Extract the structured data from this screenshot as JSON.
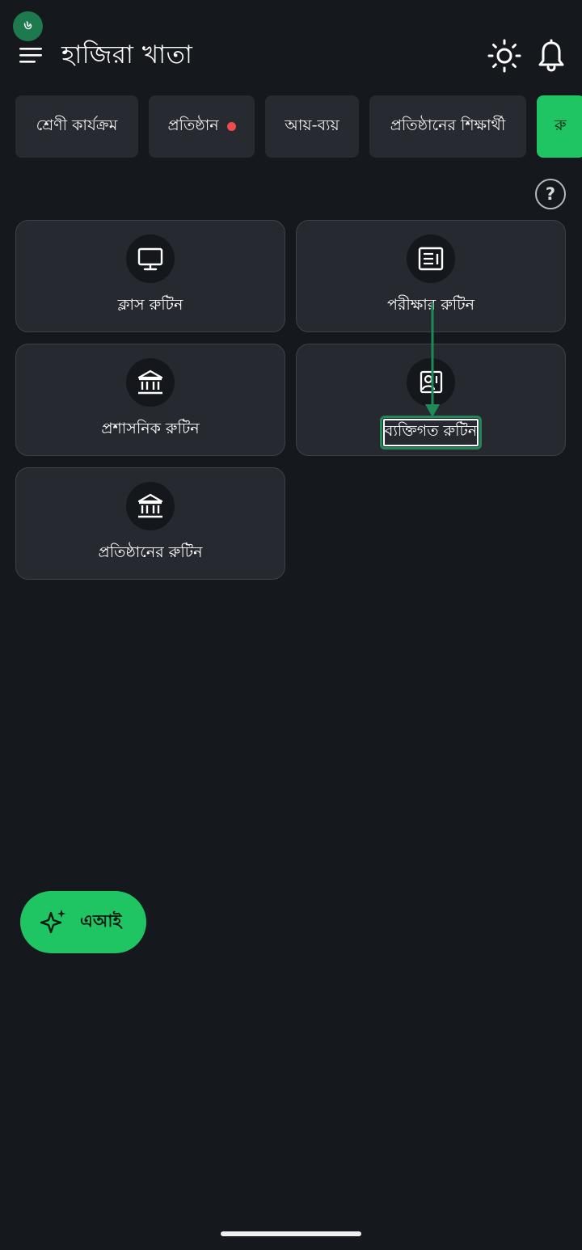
{
  "status": {
    "badge": "৬"
  },
  "header": {
    "title": "হাজিরা খাতা"
  },
  "icons": {
    "menu": "menu-icon",
    "theme": "sun-icon",
    "notifications": "bell-icon",
    "help": "help-icon"
  },
  "help": {
    "glyph": "?"
  },
  "tabs": [
    {
      "label": "শ্রেণী কার্যক্রম"
    },
    {
      "label": "প্রতিষ্ঠান"
    },
    {
      "label": "আয়-ব্যয়"
    },
    {
      "label": "প্রতিষ্ঠানের শিক্ষার্থী"
    },
    {
      "label": "রু"
    }
  ],
  "cards": [
    {
      "label": "ক্লাস রুটিন",
      "icon": "monitor-icon"
    },
    {
      "label": "পরীক্ষার রুটিন",
      "icon": "document-list-icon"
    },
    {
      "label": "প্রশাসনিক রুটিন",
      "icon": "institution-icon"
    },
    {
      "label": "ব্যক্তিগত রুটিন",
      "icon": "person-board-icon"
    },
    {
      "label": "প্রতিষ্ঠানের রুটিন",
      "icon": "institution-icon"
    }
  ],
  "fab": {
    "label": "এআই",
    "icon": "sparkle-icon"
  },
  "colors": {
    "background": "#15181c",
    "card": "#262a30",
    "accent": "#20c563",
    "notification_dot": "#ef4b4b",
    "annotation_arrow": "#1f8a57"
  }
}
